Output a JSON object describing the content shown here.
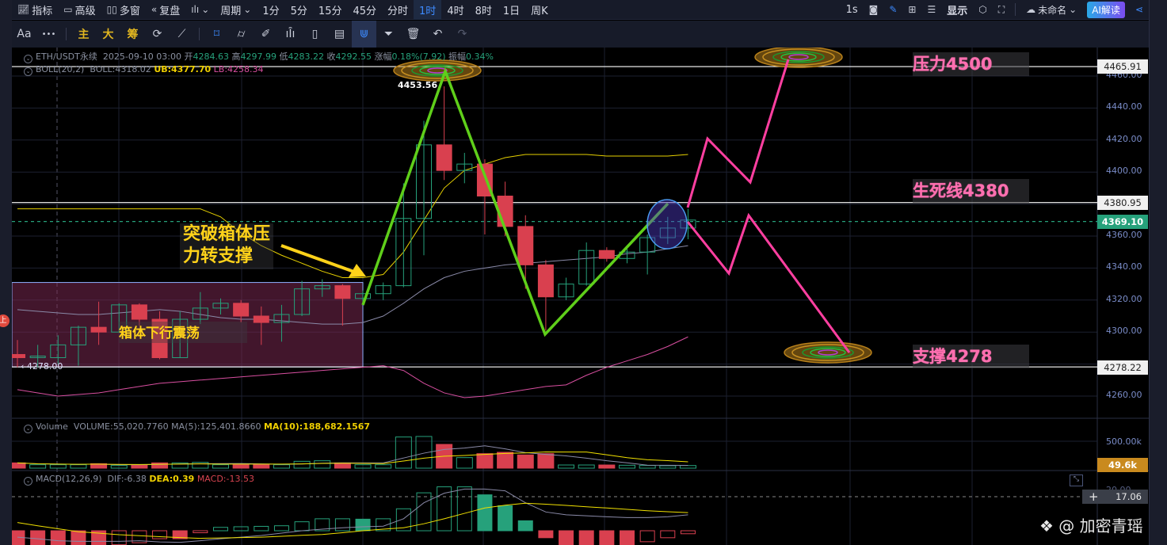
{
  "toolbar_top": {
    "left": [
      {
        "icon": "chart-icon",
        "label": "指标"
      },
      {
        "icon": "calendar-icon",
        "label": "高级"
      },
      {
        "icon": "windows-icon",
        "label": "多窗"
      },
      {
        "icon": "rewind-icon",
        "label": "复盘"
      }
    ],
    "period_label": "周期",
    "periods": [
      "1分",
      "5分",
      "15分",
      "45分",
      "分时",
      "1时",
      "4时",
      "8时",
      "1日",
      "周K"
    ],
    "active_period": "1时",
    "refresh": "1s",
    "display_label": "显示",
    "layout_name": "未命名",
    "ai_button": "AI解读"
  },
  "toolbar_draw": {
    "font_label": "Aa",
    "more": "•••",
    "overlays": [
      "主",
      "大",
      "筹"
    ]
  },
  "info": {
    "symbol": "ETH/USDT永续",
    "datetime": "2025-09-10 03:00",
    "open_label": "开",
    "open": "4284.63",
    "high_label": "高",
    "high": "4297.99",
    "low_label": "低",
    "low": "4283.22",
    "close_label": "收",
    "close": "4292.55",
    "change_label": "涨幅",
    "change": "0.18%(7.92)",
    "amp_label": "振幅",
    "amp": "0.34%",
    "boll_name": "BOLL(20,2)",
    "boll": "BOLL:4318.02",
    "ub": "UB:4377.70",
    "lb": "LB:4258.34",
    "vol_name": "Volume",
    "vol": "VOLUME:55,020.7760",
    "ma5": "MA(5):125,401.8660",
    "ma10": "MA(10):188,682.1567",
    "macd_name": "MACD(12,26,9)",
    "dif": "DIF:-6.38",
    "dea": "DEA:0.39",
    "macd": "MACD:-13.53"
  },
  "price_axis": [
    "4460.00",
    "4440.00",
    "4420.00",
    "4400.00",
    "4360.00",
    "4340.00",
    "4320.00",
    "4300.00",
    "4260.00"
  ],
  "price_lines": {
    "resistance": "4465.91",
    "lifeline": "4380.95",
    "current": "4369.10",
    "support": "4278.22"
  },
  "volume_axis": {
    "tick": "500.00k",
    "current": "49.6k"
  },
  "macd_axis": {
    "tick": "20.00",
    "current": "17.06"
  },
  "annotations": {
    "resistance": "压力4500",
    "lifeline": "生死线4380",
    "support": "支撑4278",
    "breakout": [
      "突破箱体压",
      "力转支撑"
    ],
    "range": "箱体下行震荡",
    "peak": "4453.56",
    "box_low": "4278.00"
  },
  "side_badge": "上",
  "watermark": "@ 加密青瑶",
  "colors": {
    "up": "#26a17b",
    "down": "#d9404f",
    "accent": "#3d8bff",
    "projection": "#ff3fa0",
    "zigzag": "#5fcf1a"
  },
  "chart_data": {
    "type": "candlestick",
    "title": "ETH/USDT永续 1时",
    "candles": [
      [
        4286,
        4295,
        4278,
        4284
      ],
      [
        4284,
        4292,
        4278,
        4285
      ],
      [
        4284,
        4298,
        4280,
        4292
      ],
      [
        4292,
        4304,
        4279,
        4303
      ],
      [
        4303,
        4319,
        4292,
        4300
      ],
      [
        4300,
        4318,
        4300,
        4317
      ],
      [
        4317,
        4318,
        4304,
        4308
      ],
      [
        4308,
        4313,
        4283,
        4284
      ],
      [
        4284,
        4313,
        4284,
        4308
      ],
      [
        4308,
        4325,
        4305,
        4315
      ],
      [
        4315,
        4321,
        4311,
        4318
      ],
      [
        4318,
        4320,
        4306,
        4310
      ],
      [
        4310,
        4316,
        4292,
        4306
      ],
      [
        4306,
        4317,
        4294,
        4311
      ],
      [
        4311,
        4332,
        4310,
        4327
      ],
      [
        4327,
        4333,
        4322,
        4329
      ],
      [
        4329,
        4330,
        4304,
        4321
      ],
      [
        4321,
        4326,
        4319,
        4324
      ],
      [
        4324,
        4331,
        4320,
        4329
      ],
      [
        4329,
        4393,
        4328,
        4371
      ],
      [
        4371,
        4432,
        4348,
        4417
      ],
      [
        4417,
        4453.56,
        4395,
        4401
      ],
      [
        4401,
        4412,
        4393,
        4405
      ],
      [
        4405,
        4408,
        4361,
        4385
      ],
      [
        4385,
        4394,
        4360,
        4366
      ],
      [
        4366,
        4373,
        4327,
        4342
      ],
      [
        4342,
        4345,
        4301,
        4322
      ],
      [
        4322,
        4334,
        4320,
        4330
      ],
      [
        4330,
        4356,
        4329,
        4351
      ],
      [
        4351,
        4353,
        4344,
        4346
      ],
      [
        4346,
        4352,
        4343,
        4350
      ],
      [
        4350,
        4361,
        4336,
        4359
      ],
      [
        4359,
        4372,
        4355,
        4365
      ],
      [
        4365,
        4377,
        4358,
        4370
      ]
    ],
    "boll_upper": [
      4377,
      4377,
      4377,
      4377,
      4377,
      4377,
      4377,
      4377,
      4377,
      4377,
      4372,
      4362,
      4354,
      4348,
      4343,
      4338,
      4334,
      4334,
      4336,
      4350,
      4370,
      4390,
      4401,
      4405,
      4409,
      4411,
      4411,
      4411,
      4411,
      4410,
      4410,
      4410,
      4410,
      4411
    ],
    "boll_mid": [
      4314,
      4313,
      4312,
      4311,
      4311,
      4312,
      4313,
      4314,
      4313,
      4311,
      4309,
      4308,
      4308,
      4307,
      4306,
      4305,
      4305,
      4306,
      4310,
      4318,
      4327,
      4334,
      4338,
      4340,
      4342,
      4343,
      4344,
      4345,
      4346,
      4347,
      4349,
      4350,
      4352,
      4354
    ],
    "boll_lower": [
      4264,
      4262,
      4260,
      4261,
      4262,
      4264,
      4266,
      4268,
      4269,
      4270,
      4271,
      4272,
      4273,
      4274,
      4275,
      4276,
      4277,
      4278,
      4279,
      4276,
      4268,
      4262,
      4259,
      4260,
      4262,
      4264,
      4266,
      4267,
      4273,
      4278,
      4282,
      4286,
      4291,
      4297
    ],
    "volume": [
      100000,
      65000,
      65000,
      65000,
      85000,
      50000,
      60000,
      100000,
      100000,
      110000,
      65000,
      65000,
      65000,
      65000,
      130000,
      140000,
      100000,
      65000,
      65000,
      590000,
      600000,
      450000,
      200000,
      275000,
      300000,
      250000,
      275000,
      60000,
      60000,
      60000,
      55000,
      50000,
      45000,
      49600
    ],
    "macd_hist": [
      -8,
      -8,
      -8,
      -8,
      -8,
      -7,
      -6,
      -4,
      -4,
      -1,
      1.7,
      2,
      2.2,
      2.5,
      4.5,
      6,
      6,
      5.8,
      6,
      11,
      19,
      22,
      22,
      18,
      12.5,
      5,
      -3.5,
      -8,
      -8,
      -8,
      -8,
      -5.5,
      -3.5,
      -1.5
    ],
    "dif": [
      -3.2,
      -4,
      -5,
      -5.3,
      -5.3,
      -5.3,
      -5,
      -5.6,
      -5.8,
      -5,
      -4,
      -3.2,
      -2.4,
      -1.2,
      0,
      0.8,
      1.5,
      2,
      2.3,
      6,
      14,
      18.8,
      20.9,
      20.9,
      20,
      14,
      9.4,
      8,
      7.5,
      7,
      6.6,
      6.6,
      7,
      8
    ],
    "dea": [
      4.1,
      2.5,
      1,
      -0.5,
      -1.2,
      -2,
      -2.5,
      -3,
      -3.4,
      -3.8,
      -3.6,
      -3.4,
      -3.2,
      -2.8,
      -2.3,
      -1.9,
      -1,
      0,
      0.8,
      1.5,
      3.5,
      6,
      8.7,
      11.4,
      12.8,
      13.8,
      13.3,
      12.7,
      12,
      11.4,
      10.7,
      10,
      9.5,
      9.1
    ],
    "ylim": [
      4250,
      4475
    ]
  }
}
